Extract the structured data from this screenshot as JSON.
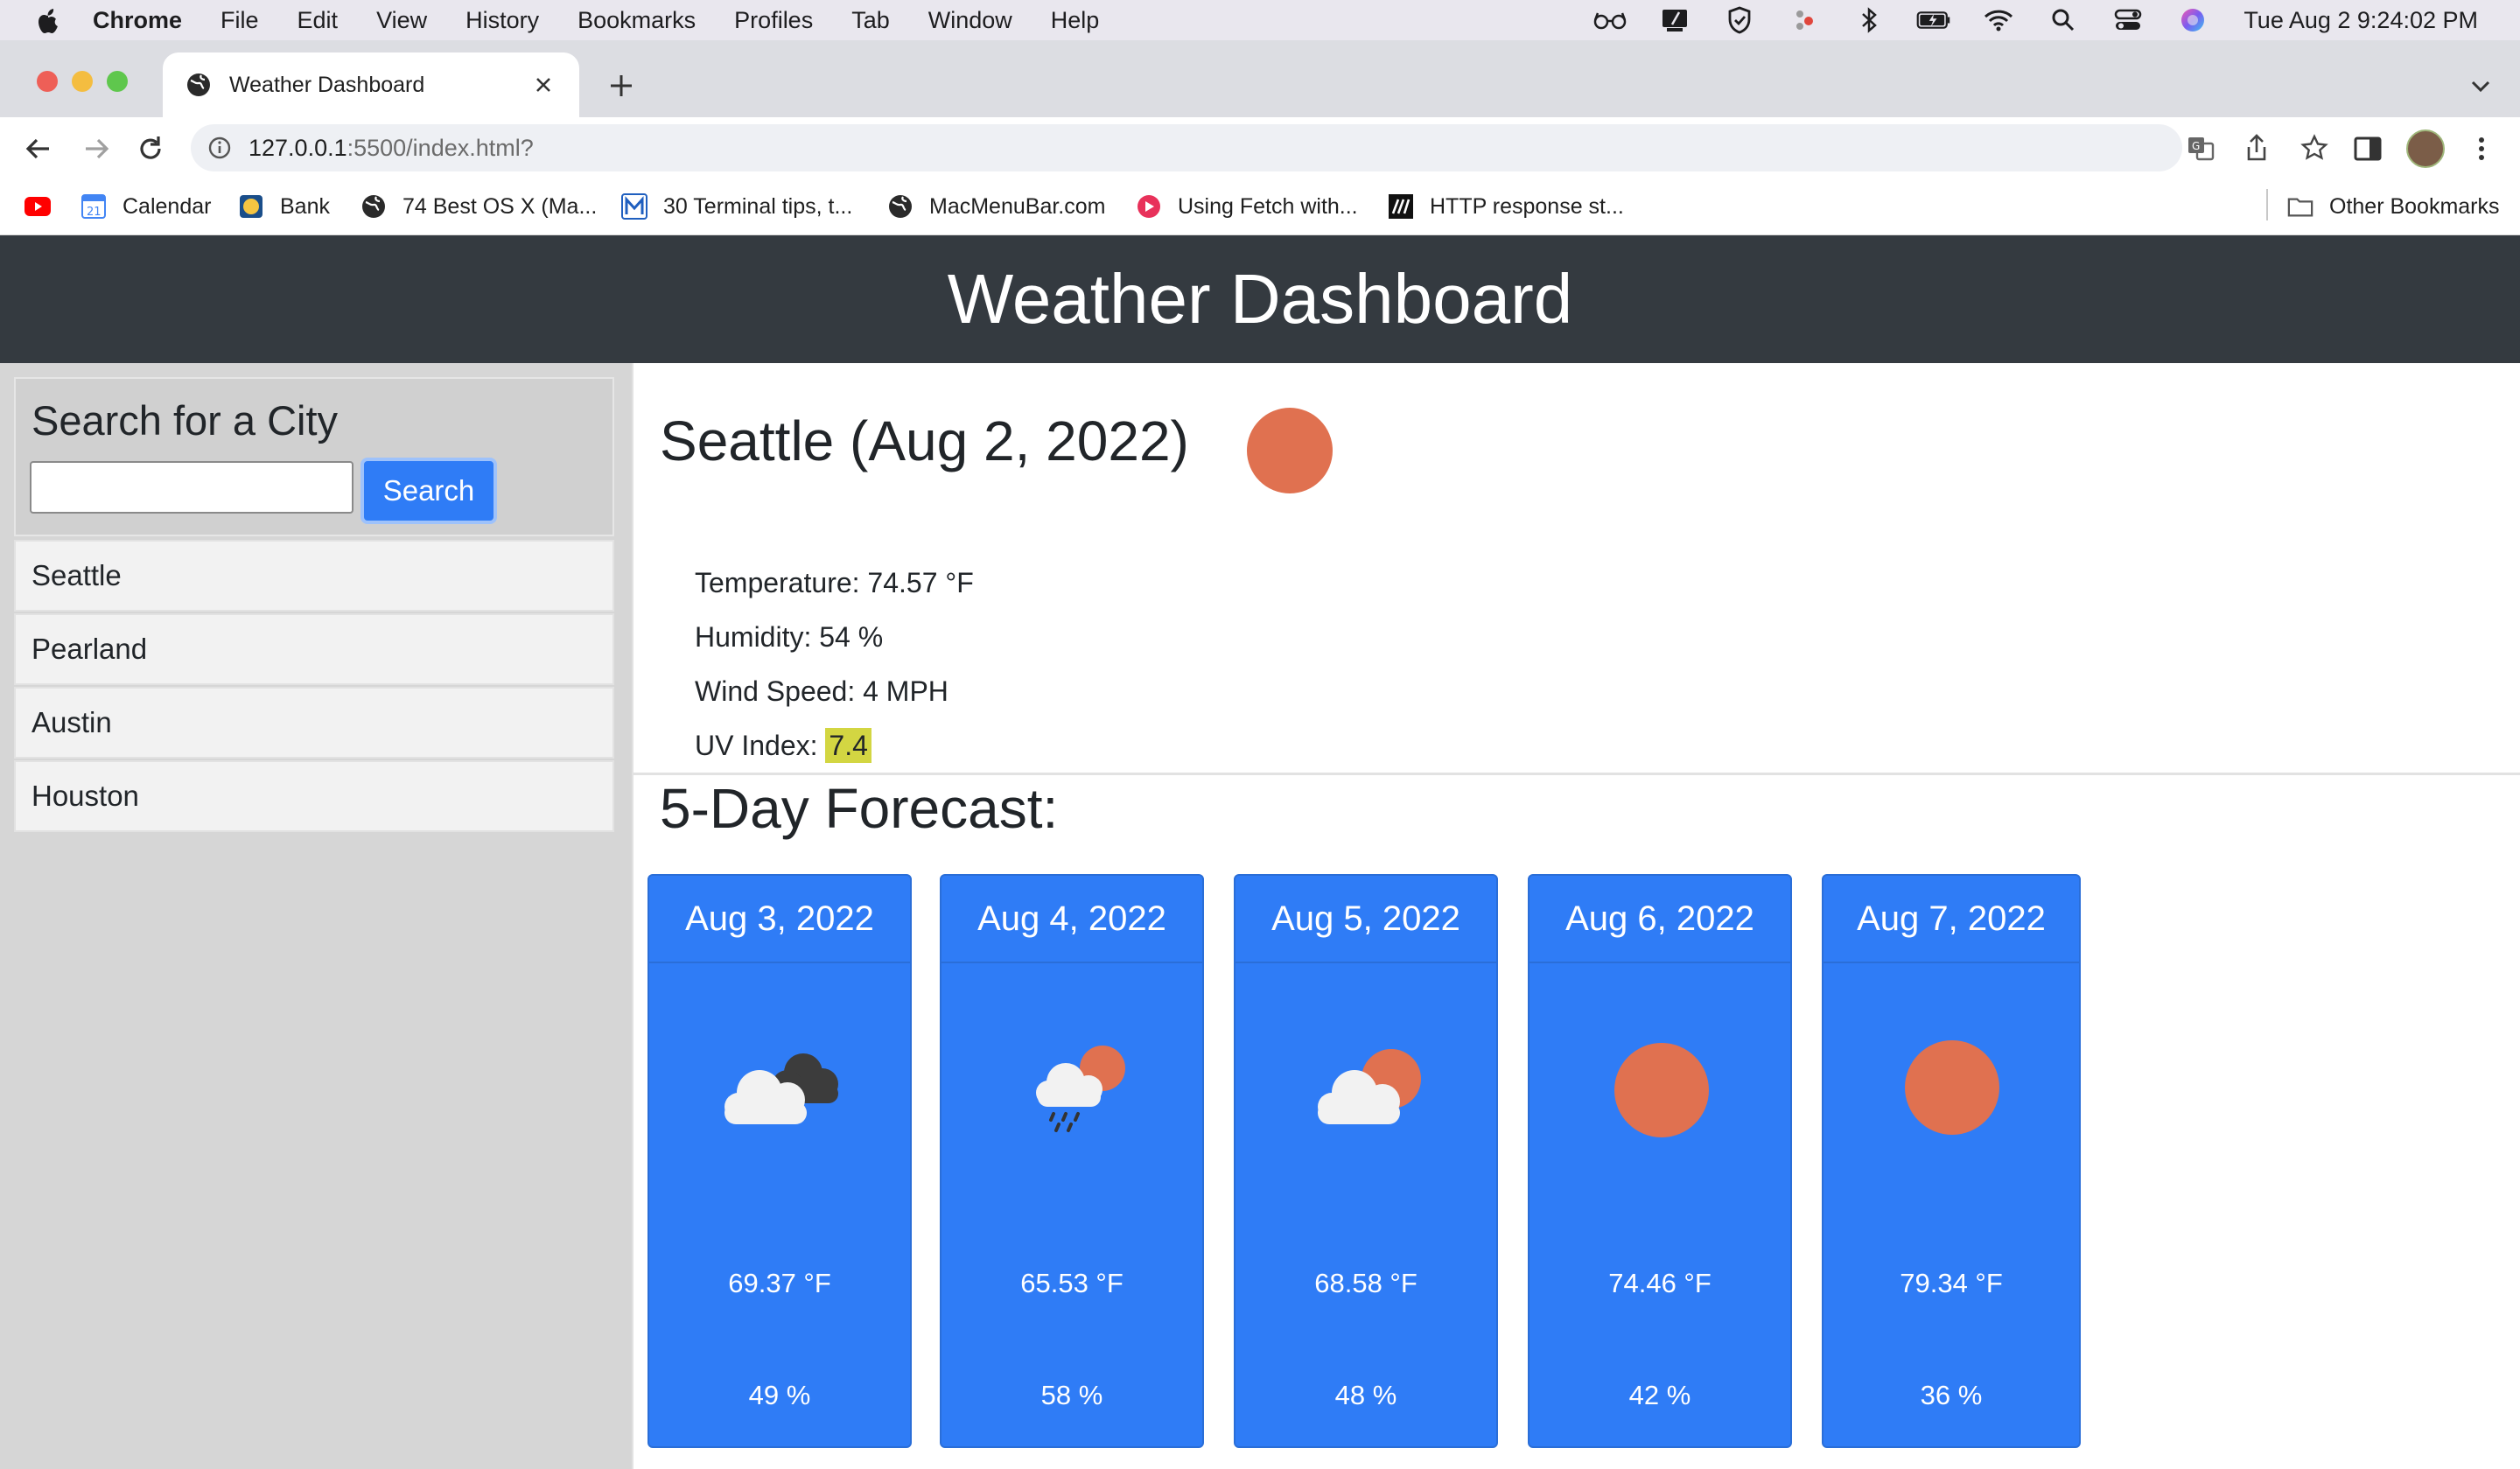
{
  "menubar": {
    "app": "Chrome",
    "items": [
      "File",
      "Edit",
      "View",
      "History",
      "Bookmarks",
      "Profiles",
      "Tab",
      "Window",
      "Help"
    ],
    "clock": "Tue Aug 2  9:24:02 PM"
  },
  "browser": {
    "tab_title": "Weather Dashboard",
    "url_host": "127.0.0.1",
    "url_rest": ":5500/index.html?",
    "bookmarks": [
      {
        "label": "",
        "icon": "youtube-icon"
      },
      {
        "label": "Calendar",
        "icon": "calendar-icon"
      },
      {
        "label": "Bank",
        "icon": "bank-icon"
      },
      {
        "label": "74 Best OS X (Ma...",
        "icon": "globe-icon"
      },
      {
        "label": "30 Terminal tips, t...",
        "icon": "m-icon"
      },
      {
        "label": "MacMenuBar.com",
        "icon": "globe-icon"
      },
      {
        "label": "Using Fetch with...",
        "icon": "red-play-icon"
      },
      {
        "label": "HTTP response st...",
        "icon": "mdn-icon"
      }
    ],
    "other_bookmarks": "Other Bookmarks"
  },
  "app": {
    "header_title": "Weather Dashboard",
    "search_heading": "Search for a City",
    "search_placeholder": "",
    "search_button": "Search",
    "history": [
      "Seattle",
      "Pearland",
      "Austin",
      "Houston"
    ],
    "current": {
      "title": "Seattle (Aug 2, 2022)",
      "icon": "sun-icon",
      "temperature": "Temperature: 74.57 °F",
      "humidity": "Humidity: 54 %",
      "wind": "Wind Speed: 4 MPH",
      "uv_label": "UV Index: ",
      "uv_value": "7.4",
      "uv_color": "#d3d642"
    },
    "forecast_title": "5-Day Forecast:",
    "forecast": [
      {
        "date": "Aug 3, 2022",
        "icon": "dark-cloud-icon",
        "temp": "69.37 °F",
        "humidity": "49 %"
      },
      {
        "date": "Aug 4, 2022",
        "icon": "rain-sun-cloud-icon",
        "temp": "65.53 °F",
        "humidity": "58 %"
      },
      {
        "date": "Aug 5, 2022",
        "icon": "partly-cloudy-icon",
        "temp": "68.58 °F",
        "humidity": "48 %"
      },
      {
        "date": "Aug 6, 2022",
        "icon": "sun-icon",
        "temp": "74.46 °F",
        "humidity": "42 %"
      },
      {
        "date": "Aug 7, 2022",
        "icon": "sun-icon",
        "temp": "79.34 °F",
        "humidity": "36 %"
      }
    ]
  },
  "colors": {
    "header_bg": "#343a40",
    "card_blue": "#2f7cf6",
    "sun": "#e07150",
    "sidebar_bg": "#d6d6d6"
  }
}
